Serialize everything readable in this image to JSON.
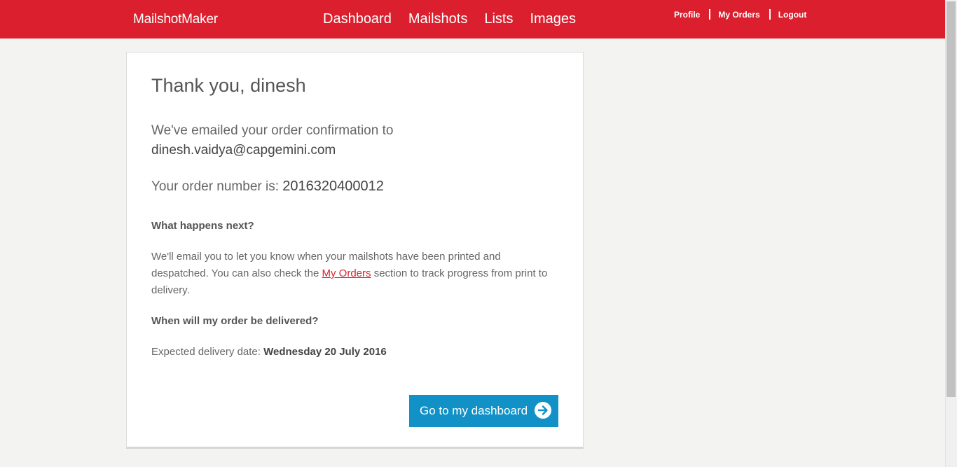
{
  "header": {
    "brand": "MailshotMaker",
    "nav": [
      "Dashboard",
      "Mailshots",
      "Lists",
      "Images"
    ],
    "user_links": [
      "Profile",
      "My Orders",
      "Logout"
    ]
  },
  "confirmation": {
    "title": "Thank you, dinesh",
    "emailed_text": "We've emailed your order confirmation to",
    "email": "dinesh.vaidya@capgemini.com",
    "order_label": "Your order number is: ",
    "order_number": "2016320400012",
    "next_heading": "What happens next?",
    "next_text_before": "We'll email you to let  you know when your mailshots have been printed and despatched. You can also check the ",
    "next_link": "My Orders",
    "next_text_after": " section to track progress from print to delivery.",
    "delivery_heading": "When will my order be delivered?",
    "delivery_label": "Expected delivery date: ",
    "delivery_date": "Wednesday 20 July 2016",
    "button_label": "Go to my dashboard"
  },
  "icons": {
    "button_icon": "arrow-right-circle-icon"
  },
  "colors": {
    "brand_red": "#dc1f2e",
    "button_blue": "#1191c6"
  }
}
